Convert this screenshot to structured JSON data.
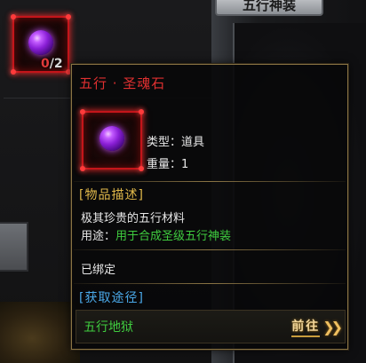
{
  "background": {
    "tab_label": "五行神装"
  },
  "slot": {
    "count_current": "0",
    "count_total": "/2",
    "icon": "purple-orb-icon"
  },
  "tooltip": {
    "title": "五行 · 圣魂石",
    "icon": "purple-orb-icon",
    "type_label": "类型：",
    "type_value": "道具",
    "weight_label": "重量：",
    "weight_value": "1",
    "description_header": "[物品描述]",
    "description_line1": "极其珍贵的五行材料",
    "usage_label": "用途：",
    "usage_value": "用于合成圣级五行神装",
    "bound_text": "已绑定",
    "source_header": "[获取途径]",
    "source_name": "五行地狱",
    "goto_label": "前往",
    "goto_icon": "double-chevron-right-icon"
  },
  "colors": {
    "title_red": "#e03030",
    "section_gold": "#e0b84a",
    "section_blue": "#4aa8e8",
    "usage_green": "#3fcc3f",
    "border_gold": "#8a7444",
    "slot_red": "#c4151a"
  }
}
